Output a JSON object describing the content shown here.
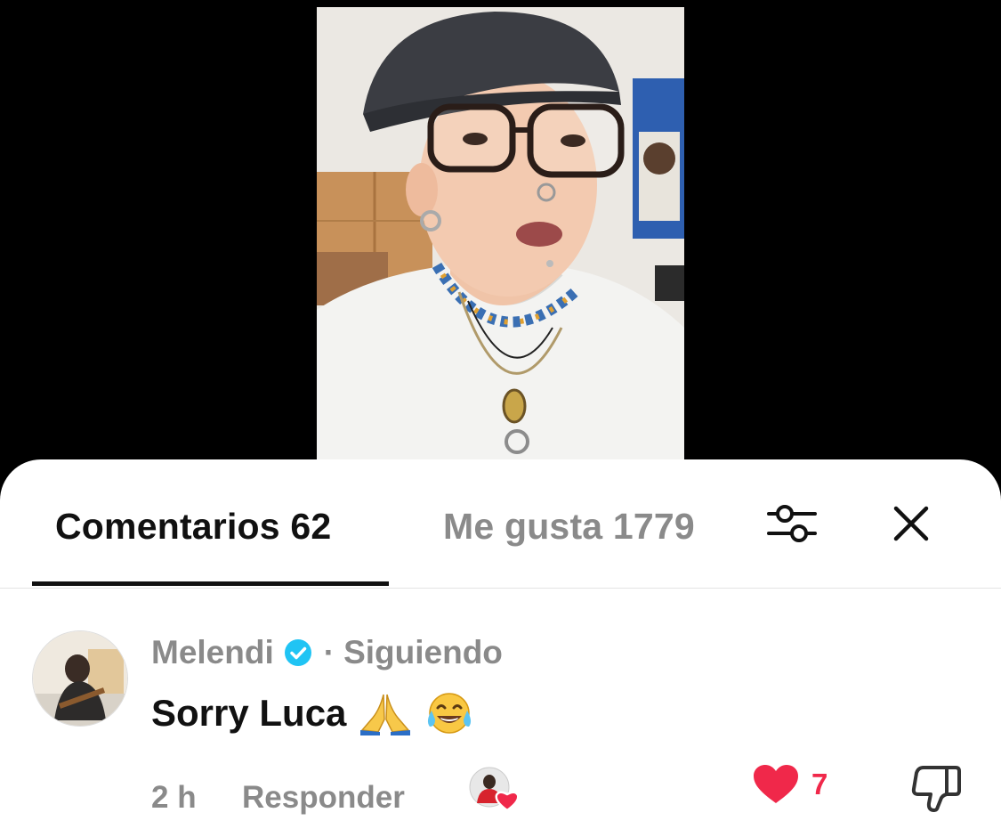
{
  "colors": {
    "background": "#000000",
    "sheet": "#ffffff",
    "primary_text": "#111111",
    "secondary_text": "#8a8a8a",
    "like_red": "#f0284a",
    "verified_blue": "#20c4f4"
  },
  "video": {
    "icon": "video-person-talking"
  },
  "tabs": {
    "comments_label": "Comentarios 62",
    "likes_label": "Me gusta 1779",
    "active": "comments"
  },
  "icons": {
    "filter": "sliders-filter-icon",
    "close": "close-x-icon",
    "verified": "verified-check-icon",
    "like": "heart-icon",
    "dislike": "thumbs-down-icon"
  },
  "comment": {
    "username": "Melendi",
    "separator": "·",
    "following_label": "Siguiendo",
    "text": "Sorry Luca",
    "emojis": [
      "folded-hands",
      "tears-of-joy"
    ],
    "time": "2 h",
    "reply_label": "Responder",
    "likes": "7",
    "liked_by_creator": true
  }
}
